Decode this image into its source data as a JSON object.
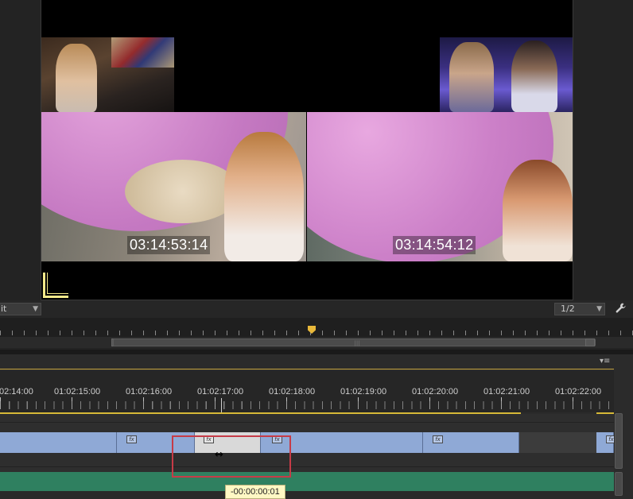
{
  "monitor": {
    "left_timecode": "03:14:53:14",
    "right_timecode": "03:14:54:12",
    "fit_label": "it",
    "resolution_label": "1/2"
  },
  "timeline": {
    "ruler_labels": [
      "02:14:00",
      "01:02:15:00",
      "01:02:16:00",
      "01:02:17:00",
      "01:02:18:00",
      "01:02:19:00",
      "01:02:20:00",
      "01:02:21:00",
      "01:02:22:00"
    ],
    "fx_label": "fx",
    "tooltip": "-00:00:00:01",
    "trim_cursor": "↔"
  },
  "icons": {
    "wrench": "wrench-icon",
    "panel_menu": "panel-menu-icon",
    "caret": "chevron-down-icon"
  },
  "colors": {
    "video_clip": "#8fa9d6",
    "audio_clip": "#2f8060",
    "highlight": "#c63b47",
    "playhead": "#e8b83a"
  }
}
